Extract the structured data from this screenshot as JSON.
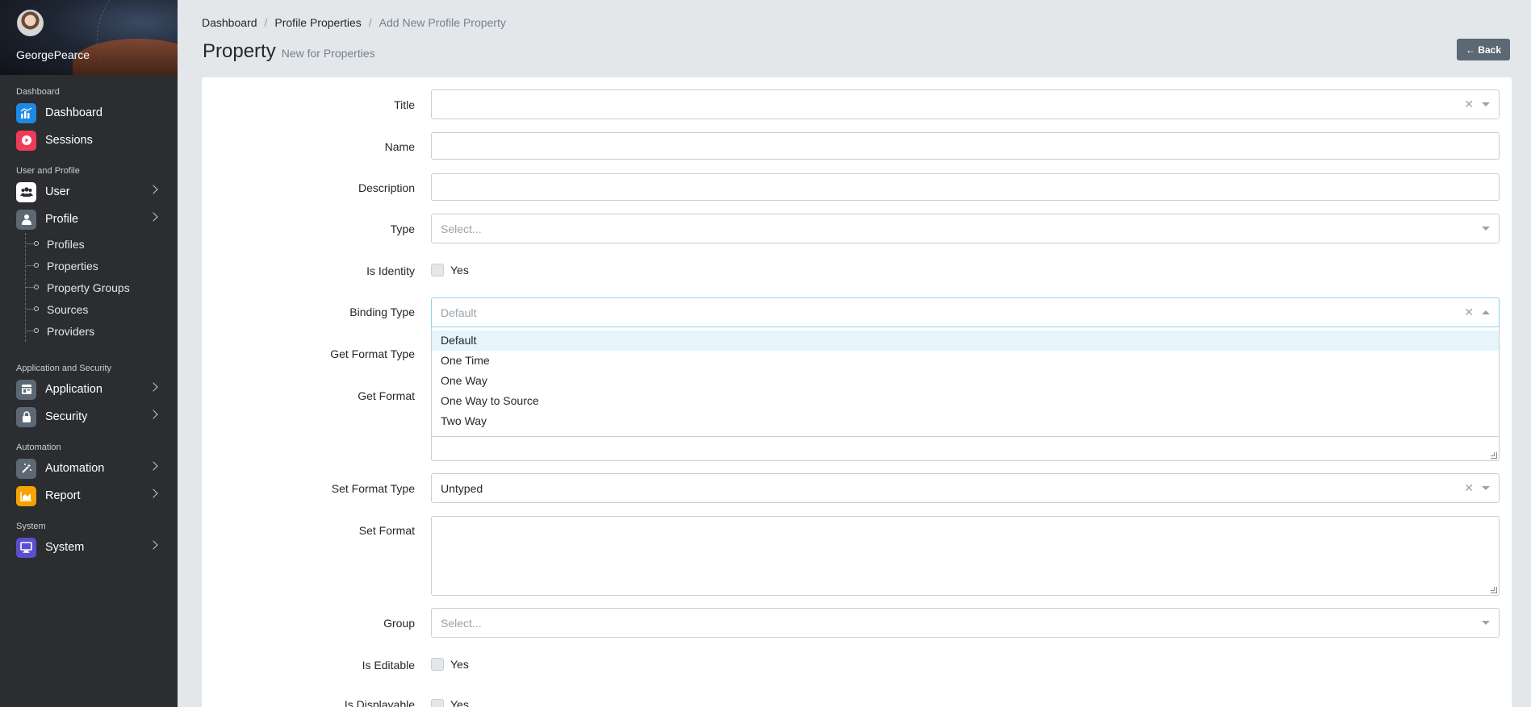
{
  "sidebar": {
    "username": "GeorgePearce",
    "sections": [
      {
        "title": "Dashboard"
      },
      {
        "title": "User and Profile"
      },
      {
        "title": "Application and Security"
      },
      {
        "title": "Automation"
      },
      {
        "title": "System"
      }
    ],
    "items": {
      "dashboard": "Dashboard",
      "sessions": "Sessions",
      "user": "User",
      "profile": "Profile",
      "application": "Application",
      "security": "Security",
      "automation": "Automation",
      "report": "Report",
      "system": "System"
    },
    "profile_sub": [
      "Profiles",
      "Properties",
      "Property Groups",
      "Sources",
      "Providers"
    ],
    "colors": {
      "dashboard": "#20a8d8",
      "sessions": "#f86c6b",
      "report": "#ffc107",
      "system": "#6f42c1",
      "gray": "#5c6873"
    }
  },
  "breadcrumb": [
    "Dashboard",
    "Profile Properties",
    "Add New Profile Property"
  ],
  "header": {
    "title": "Property",
    "subtitle": "New for Properties",
    "back": "← Back"
  },
  "form": {
    "title_label": "Title",
    "name_label": "Name",
    "description_label": "Description",
    "type_label": "Type",
    "type_placeholder": "Select...",
    "is_identity_label": "Is Identity",
    "yes": "Yes",
    "binding_type_label": "Binding Type",
    "binding_type_placeholder": "Default",
    "binding_options": [
      "Default",
      "One Time",
      "One Way",
      "One Way to Source",
      "Two Way"
    ],
    "get_format_type_label": "Get Format Type",
    "get_format_label": "Get Format",
    "set_format_type_label": "Set Format Type",
    "set_format_type_value": "Untyped",
    "set_format_label": "Set Format",
    "group_label": "Group",
    "group_placeholder": "Select...",
    "is_editable_label": "Is Editable",
    "is_displayable_label": "Is Displayable"
  }
}
